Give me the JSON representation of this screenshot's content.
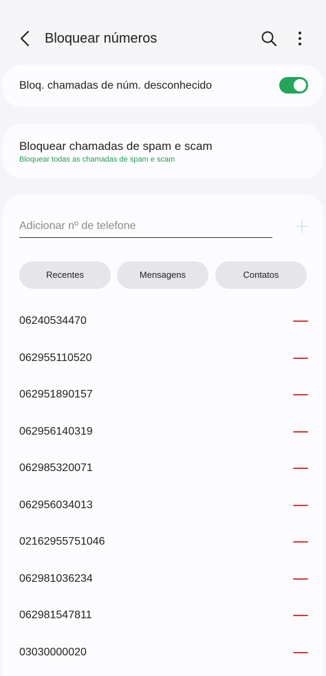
{
  "header": {
    "title": "Bloquear números"
  },
  "icons": {
    "back": "chevron-left-icon",
    "search": "search-icon",
    "more": "more-vertical-icon",
    "add": "plus-icon",
    "remove": "minus-icon"
  },
  "unknown_block": {
    "label": "Bloq. chamadas de núm. desconhecido",
    "enabled": true
  },
  "spam_block": {
    "title": "Bloquear chamadas de spam e scam",
    "subtitle": "Bloquear todas as chamadas de spam e scam"
  },
  "add_number": {
    "placeholder": "Adicionar nº de telefone",
    "value": ""
  },
  "chips": [
    {
      "label": "Recentes"
    },
    {
      "label": "Mensagens"
    },
    {
      "label": "Contatos"
    }
  ],
  "blocked_numbers": [
    "06240534470",
    "062955110520",
    "062951890157",
    "062956140319",
    "062985320071",
    "062956034013",
    "02162955751046",
    "062981036234",
    "062981547811",
    "03030000020"
  ],
  "colors": {
    "accent": "#23a65a",
    "remove": "#d63a34"
  }
}
